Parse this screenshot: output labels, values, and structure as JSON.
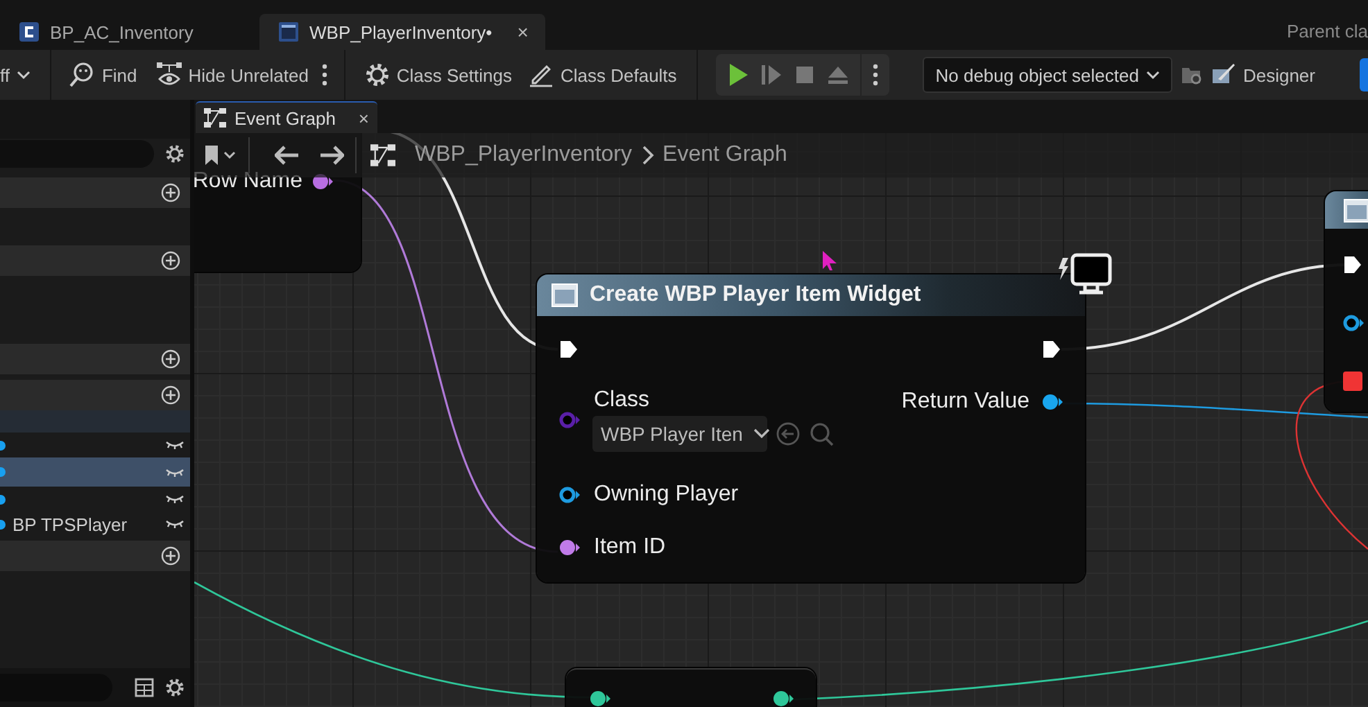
{
  "tabs": [
    {
      "label": "BP_AC_Inventory",
      "selected": false,
      "kind": "blueprint"
    },
    {
      "label": "WBP_PlayerInventory•",
      "selected": true,
      "kind": "widget",
      "close": "×"
    }
  ],
  "parent_class": "Parent cla",
  "toolbar": {
    "mode": "ff",
    "items": [
      {
        "kind": "find",
        "label": "Find"
      },
      {
        "kind": "hide",
        "label": "Hide Unrelated"
      },
      {
        "kind": "settings",
        "label": "Class Settings"
      },
      {
        "kind": "defaults",
        "label": "Class Defaults"
      }
    ],
    "debug_object": "No debug object selected",
    "designer": "Designer"
  },
  "sidebar": {
    "sections": [
      {
        "add_button": true
      },
      {
        "add_button": true
      },
      {
        "add_button": true
      },
      {
        "add_button": true,
        "rows": [
          {
            "selected": false,
            "exposed": false
          },
          {
            "selected": true,
            "exposed": false
          },
          {
            "selected": false,
            "exposed": false
          },
          {
            "label": "BP TPSPlayer",
            "selected": false,
            "exposed": false
          }
        ]
      },
      {
        "add_button": true
      }
    ]
  },
  "graph": {
    "tab": {
      "label": "Event Graph",
      "close": "×"
    },
    "breadcrumb": [
      "WBP_PlayerInventory",
      "Event Graph"
    ],
    "row_name_node": {
      "pins": [
        {
          "kind": "data",
          "label": "Row Name",
          "color": "#b86ee2",
          "connected": true
        }
      ]
    },
    "create_widget_node": {
      "title": "Create WBP Player Item Widget",
      "inputs": [
        {
          "kind": "exec",
          "connected": true
        },
        {
          "kind": "class",
          "label": "Class",
          "color": "#5a1fa8",
          "connected": false,
          "value": "WBP Player Iten"
        },
        {
          "kind": "data",
          "label": "Owning Player",
          "color": "#1e9be0",
          "connected": false
        },
        {
          "kind": "data",
          "label": "Item ID",
          "color": "#c07be8",
          "connected": true
        }
      ],
      "outputs": [
        {
          "kind": "exec",
          "connected": true
        },
        {
          "kind": "data",
          "label": "Return Value",
          "color": "#19a6ef",
          "connected": true
        }
      ]
    },
    "right_node": {
      "pins": [
        {
          "kind": "exec",
          "connected": true
        },
        {
          "kind": "data",
          "color": "#1e9be0",
          "connected": false
        },
        {
          "kind": "struct",
          "color": "#f03434",
          "connected": true
        }
      ]
    },
    "bottom_node": {
      "pins": [
        {
          "kind": "data",
          "color": "#2fc79a",
          "connected": true
        },
        {
          "kind": "data",
          "color": "#2fc79a",
          "connected": true
        }
      ]
    }
  }
}
